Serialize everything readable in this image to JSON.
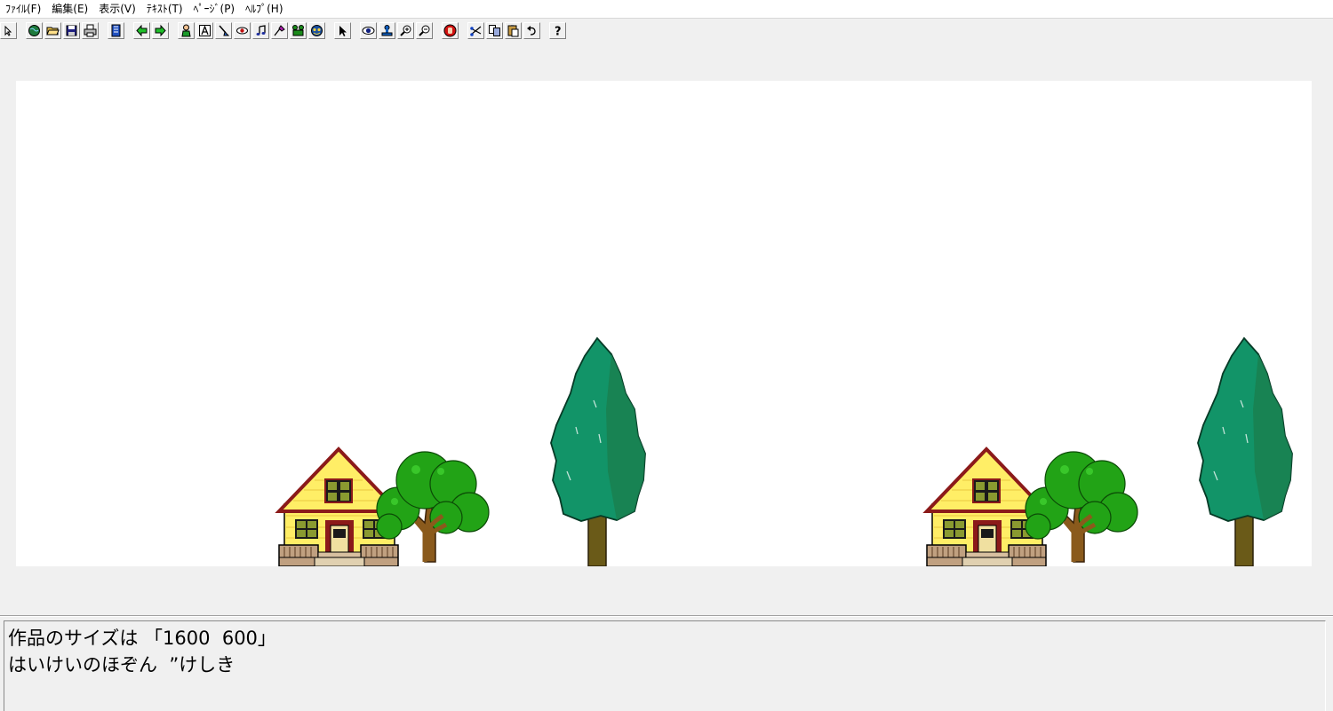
{
  "menu": {
    "file": "ﾌｧｲﾙ(F)",
    "edit": "編集(E)",
    "view": "表示(V)",
    "text": "ﾃｷｽﾄ(T)",
    "page": "ﾍﾟｰｼﾞ(P)",
    "help": "ﾍﾙﾌﾟ(H)"
  },
  "toolbar": {
    "icons": [
      "pointer-small-icon",
      "globe-icon",
      "open-folder-icon",
      "save-icon",
      "print-icon",
      "book-icon",
      "arrow-left-icon",
      "arrow-right-icon",
      "character-icon",
      "text-a-icon",
      "brush-icon",
      "eye-shape-icon",
      "music-note-icon",
      "paint-icon",
      "film-icon",
      "mask-icon",
      "cursor-icon",
      "eye-icon",
      "stamp-icon",
      "zoom-in-icon",
      "zoom-out-icon",
      "stop-hand-icon",
      "cut-icon",
      "copy-icon",
      "paste-icon",
      "undo-icon",
      "help-question-icon"
    ]
  },
  "colors": {
    "house_wall": "#ffee66",
    "roof": "#8b1a1a",
    "leaf_round": "#22a316",
    "leaf_tall": "#129468",
    "trunk": "#8a5a1c"
  },
  "info": {
    "line1": "作品のサイズは 「1600  600」",
    "line2": "はいけいのほぞん  ”けしき"
  }
}
